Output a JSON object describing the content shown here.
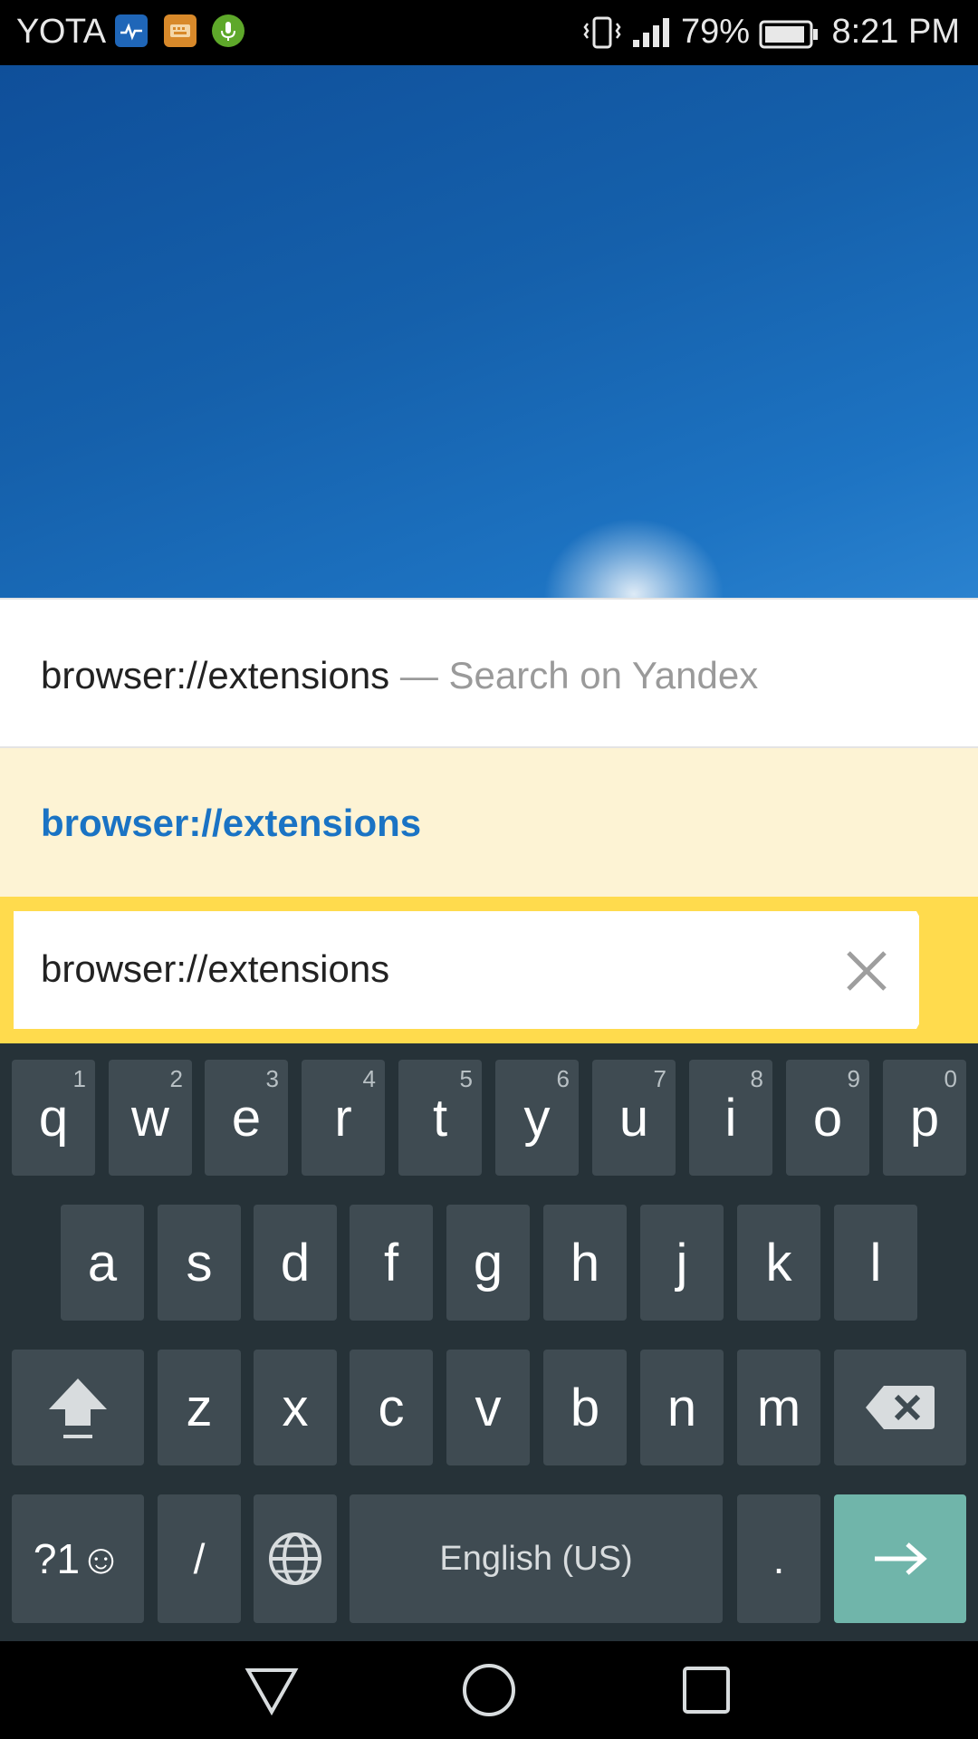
{
  "status_bar": {
    "carrier": "YOTA",
    "battery_percent": "79%",
    "time": "8:21 PM",
    "notification_icons": [
      "health-app-icon",
      "keyboard-app-icon",
      "microphone-app-icon"
    ]
  },
  "suggestions": {
    "search": {
      "query": "browser://extensions",
      "hint": " — Search on Yandex"
    },
    "url": {
      "text": "browser://extensions"
    }
  },
  "address_bar": {
    "value": "browser://extensions",
    "accent_color": "#ffdb4d"
  },
  "keyboard": {
    "row1": [
      {
        "label": "q",
        "hint": "1"
      },
      {
        "label": "w",
        "hint": "2"
      },
      {
        "label": "e",
        "hint": "3"
      },
      {
        "label": "r",
        "hint": "4"
      },
      {
        "label": "t",
        "hint": "5"
      },
      {
        "label": "y",
        "hint": "6"
      },
      {
        "label": "u",
        "hint": "7"
      },
      {
        "label": "i",
        "hint": "8"
      },
      {
        "label": "o",
        "hint": "9"
      },
      {
        "label": "p",
        "hint": "0"
      }
    ],
    "row2": [
      "a",
      "s",
      "d",
      "f",
      "g",
      "h",
      "j",
      "k",
      "l"
    ],
    "row3": [
      "z",
      "x",
      "c",
      "v",
      "b",
      "n",
      "m"
    ],
    "symbols_label": "?1☺",
    "slash_label": "/",
    "space_label": "English (US)",
    "period_label": ".",
    "enter_color": "#70b5aa"
  }
}
